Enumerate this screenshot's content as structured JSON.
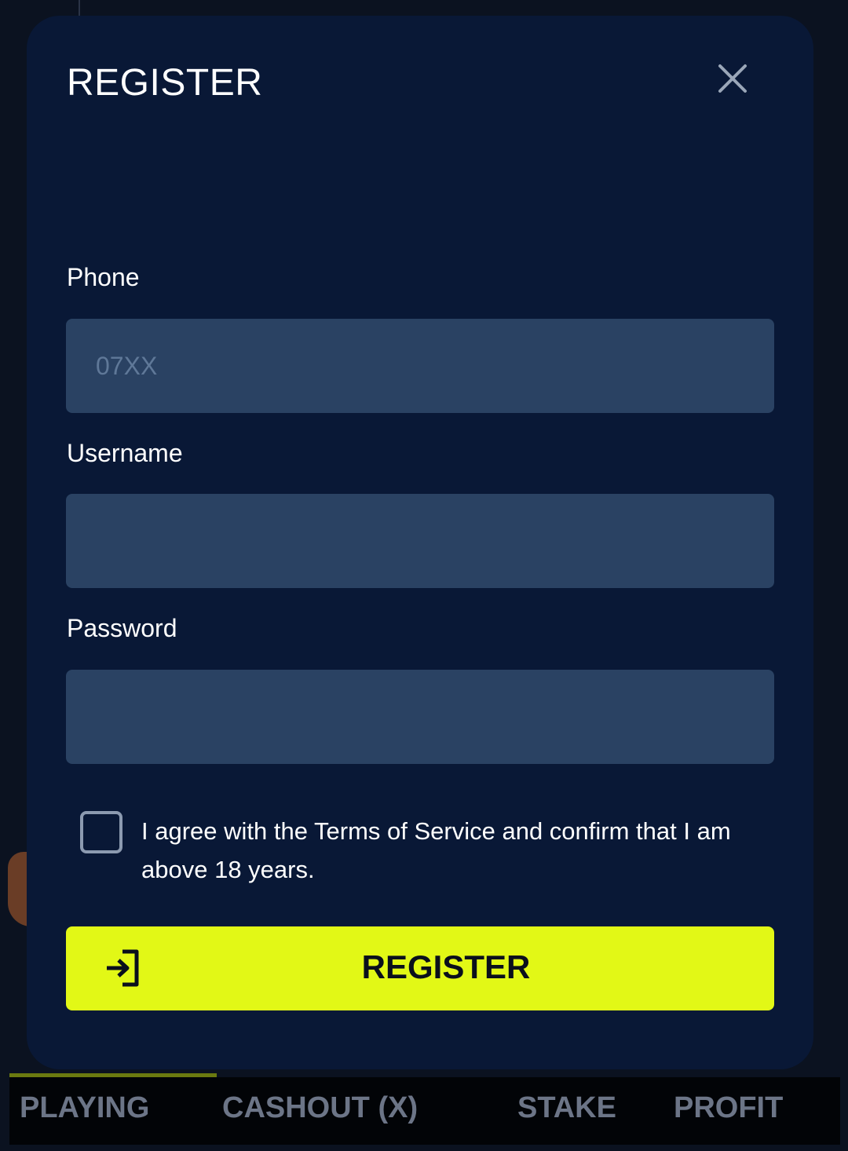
{
  "modal": {
    "title": "REGISTER",
    "close_icon": "close-icon"
  },
  "form": {
    "phone": {
      "label": "Phone",
      "placeholder": "07XX",
      "value": ""
    },
    "username": {
      "label": "Username",
      "placeholder": "",
      "value": ""
    },
    "password": {
      "label": "Password",
      "placeholder": "",
      "value": ""
    },
    "agree": {
      "checked": false,
      "text": "I agree with the Terms of Service and confirm that I am above 18 years."
    },
    "submit": {
      "label": "REGISTER",
      "icon": "login-icon"
    }
  },
  "table_header": {
    "columns": [
      "PLAYING",
      "CASHOUT (X)",
      "STAKE",
      "PROFIT"
    ]
  },
  "colors": {
    "modal_bg": "#091836",
    "input_bg": "#2a4263",
    "accent": "#e2f816"
  }
}
